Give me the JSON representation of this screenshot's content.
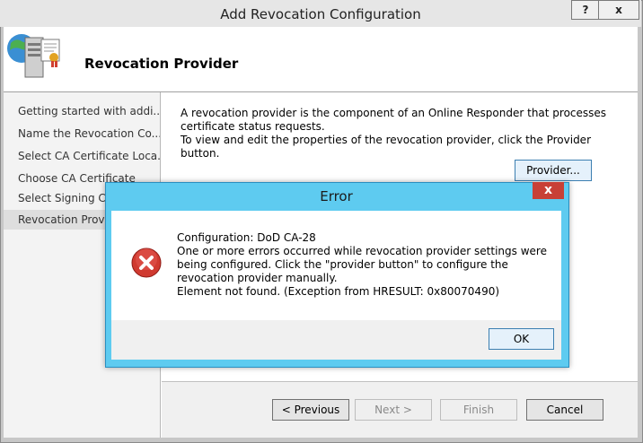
{
  "window": {
    "title": "Add Revocation Configuration",
    "help_label": "?",
    "close_label": "x"
  },
  "header": {
    "heading": "Revocation Provider"
  },
  "nav": {
    "items": [
      {
        "label": "Getting started with addi..."
      },
      {
        "label": "Name the Revocation Co..."
      },
      {
        "label": "Select CA Certificate Loca..."
      },
      {
        "label": "Choose CA Certificate"
      },
      {
        "label": "Select Signing Cert"
      },
      {
        "label": "Revocation Provid"
      }
    ]
  },
  "content": {
    "description_line1": "A revocation provider is the component of an Online Responder that processes certificate status requests.",
    "description_line2": "To view and edit the properties of the revocation provider, click the Provider button.",
    "provider_button": "Provider..."
  },
  "footer": {
    "previous": "< Previous",
    "next": "Next >",
    "finish": "Finish",
    "cancel": "Cancel"
  },
  "error_dialog": {
    "title": "Error",
    "close_label": "x",
    "line_config": "Configuration: DoD CA-28",
    "line_message": "One or more errors occurred while revocation provider settings were being configured. Click the \"provider button\" to configure the revocation provider manually.",
    "line_exception": "Element not found. (Exception from HRESULT: 0x80070490)",
    "ok": "OK",
    "icon": "error-icon"
  },
  "colors": {
    "dialog_frame": "#5ecbf0",
    "close_red": "#c84036",
    "focus_blue": "#3c7fb1"
  }
}
